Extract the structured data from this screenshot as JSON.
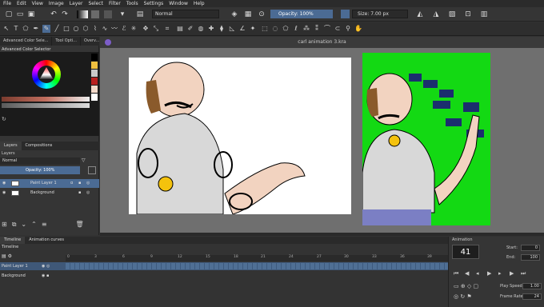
{
  "menu": [
    "File",
    "Edit",
    "View",
    "Image",
    "Layer",
    "Select",
    "Filter",
    "Tools",
    "Settings",
    "Window",
    "Help"
  ],
  "toolbar": {
    "blend_mode": "Normal",
    "opacity": "Opacity: 100%",
    "size": "Size: 7.00 px"
  },
  "docker_tabs": [
    "Advanced Color Sele...",
    "Tool Opti...",
    "Overv..."
  ],
  "advanced_color_selector": "Advanced Color Selector",
  "layer_tabs": [
    "Layers",
    "Compositions"
  ],
  "layers_panel": {
    "title": "Layers",
    "blend_mode": "Normal",
    "opacity": "Opacity: 100%",
    "layers": [
      "Paint Layer 1",
      "Background"
    ]
  },
  "document_title": "carl animation 3.kra",
  "bottom_tabs": [
    "Timeline",
    "Animation curves"
  ],
  "timeline": {
    "title": "Timeline",
    "frame_numbers": [
      "0",
      "3",
      "6",
      "9",
      "12",
      "15",
      "18",
      "21",
      "24",
      "27",
      "30",
      "33",
      "36",
      "39"
    ],
    "rows": [
      "Paint Layer 1",
      "Background"
    ]
  },
  "animation": {
    "title": "Animation",
    "current_frame": "41",
    "start_label": "Start:",
    "start_value": "0",
    "end_label": "End:",
    "end_value": "100",
    "play_speed_label": "Play Speed:",
    "play_speed_value": "1.00",
    "frame_rate_label": "Frame Rate:",
    "frame_rate_value": "24"
  },
  "colors": {
    "accent": "#4b6b94",
    "green_bg": "#13d913",
    "skin": "#f2d3c0",
    "navy": "#1b2e6e"
  }
}
